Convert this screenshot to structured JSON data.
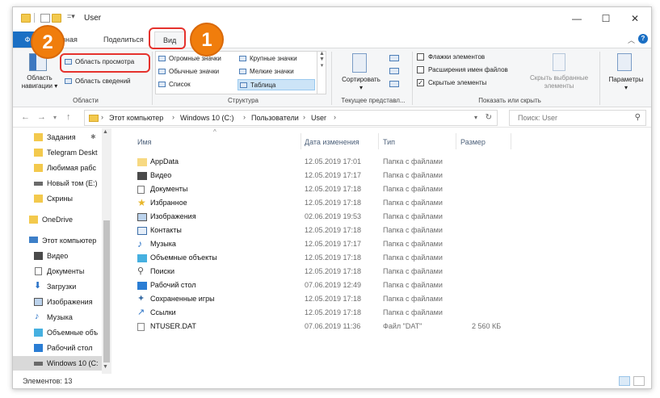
{
  "window": {
    "title": "User"
  },
  "ribbon": {
    "tabs": {
      "file": "Ф",
      "home": "лавная",
      "share": "Поделиться",
      "view": "Вид"
    },
    "nav_pane_btn": "Область навигации",
    "preview_pane": "Область просмотра",
    "details_pane": "Область сведений",
    "group_areas": "Области",
    "layouts": [
      "Огромные значки",
      "Крупные значки",
      "Обычные значки",
      "Мелкие значки",
      "Список",
      "Таблица"
    ],
    "group_structure": "Структура",
    "sort_btn": "Сортировать",
    "group_current_view": "Текущее представл...",
    "checkboxes": [
      {
        "label": "Флажки элементов",
        "checked": false
      },
      {
        "label": "Расширения имен файлов",
        "checked": false
      },
      {
        "label": "Скрытые элементы",
        "checked": true
      }
    ],
    "hide_selected": "Скрыть выбранные элементы",
    "group_show_hide": "Показать или скрыть",
    "options": "Параметры"
  },
  "annotations": {
    "badge1": "1",
    "badge2": "2"
  },
  "address": {
    "crumbs": [
      "Этот компьютер",
      "Windows 10 (C:)",
      "Пользователи",
      "User"
    ],
    "search_placeholder": "Поиск: User"
  },
  "nav": {
    "items": [
      {
        "label": "Задания",
        "icon": "folder-icon"
      },
      {
        "label": "Telegram Deskt",
        "icon": "folder-icon"
      },
      {
        "label": "Любимая рабс",
        "icon": "folder-icon"
      },
      {
        "label": "Новый том (E:)",
        "icon": "drive-icon"
      },
      {
        "label": "Скрины",
        "icon": "folder-icon"
      },
      {
        "label": "OneDrive",
        "icon": "folder-icon"
      },
      {
        "label": "Этот компьютер",
        "icon": "computer-icon"
      },
      {
        "label": "Видео",
        "icon": "video-icon"
      },
      {
        "label": "Документы",
        "icon": "document-icon"
      },
      {
        "label": "Загрузки",
        "icon": "download-icon"
      },
      {
        "label": "Изображения",
        "icon": "image-icon"
      },
      {
        "label": "Музыка",
        "icon": "music-icon"
      },
      {
        "label": "Объемные объ",
        "icon": "cube-icon"
      },
      {
        "label": "Рабочий стол",
        "icon": "desktop-icon"
      },
      {
        "label": "Windows 10 (C:",
        "icon": "drive-icon"
      }
    ]
  },
  "files": {
    "headers": {
      "name": "Имя",
      "date": "Дата изменения",
      "type": "Тип",
      "size": "Размер"
    },
    "rows": [
      {
        "name": "AppData",
        "date": "12.05.2019 17:01",
        "type": "Папка с файлами",
        "size": "",
        "icon": "folder-icon"
      },
      {
        "name": "Видео",
        "date": "12.05.2019 17:17",
        "type": "Папка с файлами",
        "size": "",
        "icon": "video-icon"
      },
      {
        "name": "Документы",
        "date": "12.05.2019 17:18",
        "type": "Папка с файлами",
        "size": "",
        "icon": "document-icon"
      },
      {
        "name": "Избранное",
        "date": "12.05.2019 17:18",
        "type": "Папка с файлами",
        "size": "",
        "icon": "star-icon"
      },
      {
        "name": "Изображения",
        "date": "02.06.2019 19:53",
        "type": "Папка с файлами",
        "size": "",
        "icon": "image-icon"
      },
      {
        "name": "Контакты",
        "date": "12.05.2019 17:18",
        "type": "Папка с файлами",
        "size": "",
        "icon": "contacts-icon"
      },
      {
        "name": "Музыка",
        "date": "12.05.2019 17:17",
        "type": "Папка с файлами",
        "size": "",
        "icon": "music-icon"
      },
      {
        "name": "Объемные объекты",
        "date": "12.05.2019 17:18",
        "type": "Папка с файлами",
        "size": "",
        "icon": "cube-icon"
      },
      {
        "name": "Поиски",
        "date": "12.05.2019 17:18",
        "type": "Папка с файлами",
        "size": "",
        "icon": "search-icon"
      },
      {
        "name": "Рабочий стол",
        "date": "07.06.2019 12:49",
        "type": "Папка с файлами",
        "size": "",
        "icon": "desktop-icon"
      },
      {
        "name": "Сохраненные игры",
        "date": "12.05.2019 17:18",
        "type": "Папка с файлами",
        "size": "",
        "icon": "games-icon"
      },
      {
        "name": "Ссылки",
        "date": "12.05.2019 17:18",
        "type": "Папка с файлами",
        "size": "",
        "icon": "link-icon"
      },
      {
        "name": "NTUSER.DAT",
        "date": "07.06.2019 11:36",
        "type": "Файл \"DAT\"",
        "size": "2 560 КБ",
        "icon": "file-icon"
      }
    ]
  },
  "status": {
    "count": "Элементов: 13"
  },
  "colors": {
    "accent": "#1a6fc4",
    "highlight": "#e5322d",
    "badge": "#f07d0c",
    "folder": "#f3c94d"
  }
}
